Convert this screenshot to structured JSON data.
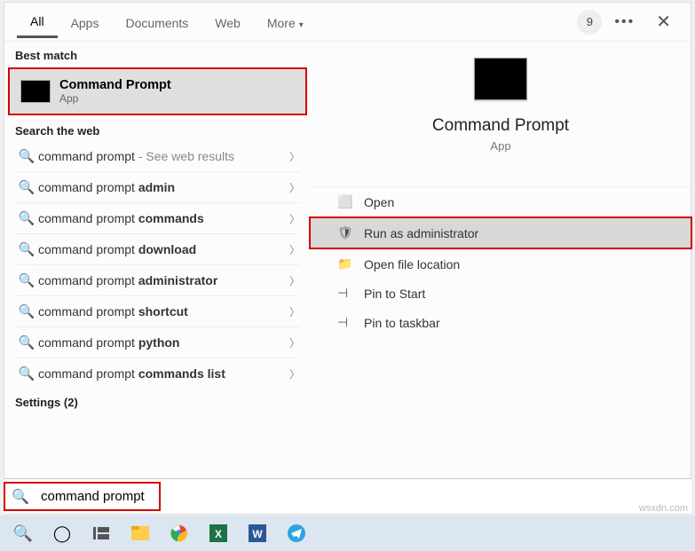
{
  "tabs": {
    "all": "All",
    "apps": "Apps",
    "documents": "Documents",
    "web": "Web",
    "more": "More"
  },
  "badge": "9",
  "groups": {
    "best": "Best match",
    "web": "Search the web",
    "settings": "Settings (2)"
  },
  "best": {
    "name": "Command Prompt",
    "sub": "App"
  },
  "web_rows": [
    {
      "pre": "command prompt",
      "bold": "",
      "hint": " - See web results"
    },
    {
      "pre": "command prompt ",
      "bold": "admin",
      "hint": ""
    },
    {
      "pre": "command prompt ",
      "bold": "commands",
      "hint": ""
    },
    {
      "pre": "command prompt ",
      "bold": "download",
      "hint": ""
    },
    {
      "pre": "command prompt ",
      "bold": "administrator",
      "hint": ""
    },
    {
      "pre": "command prompt ",
      "bold": "shortcut",
      "hint": ""
    },
    {
      "pre": "command prompt ",
      "bold": "python",
      "hint": ""
    },
    {
      "pre": "command prompt ",
      "bold": "commands list",
      "hint": ""
    }
  ],
  "preview": {
    "title": "Command Prompt",
    "sub": "App"
  },
  "actions": {
    "open": "Open",
    "runas": "Run as administrator",
    "loc": "Open file location",
    "pinstart": "Pin to Start",
    "pintask": "Pin to taskbar"
  },
  "search": {
    "value": "command prompt"
  },
  "watermark": "wsxdn.com"
}
